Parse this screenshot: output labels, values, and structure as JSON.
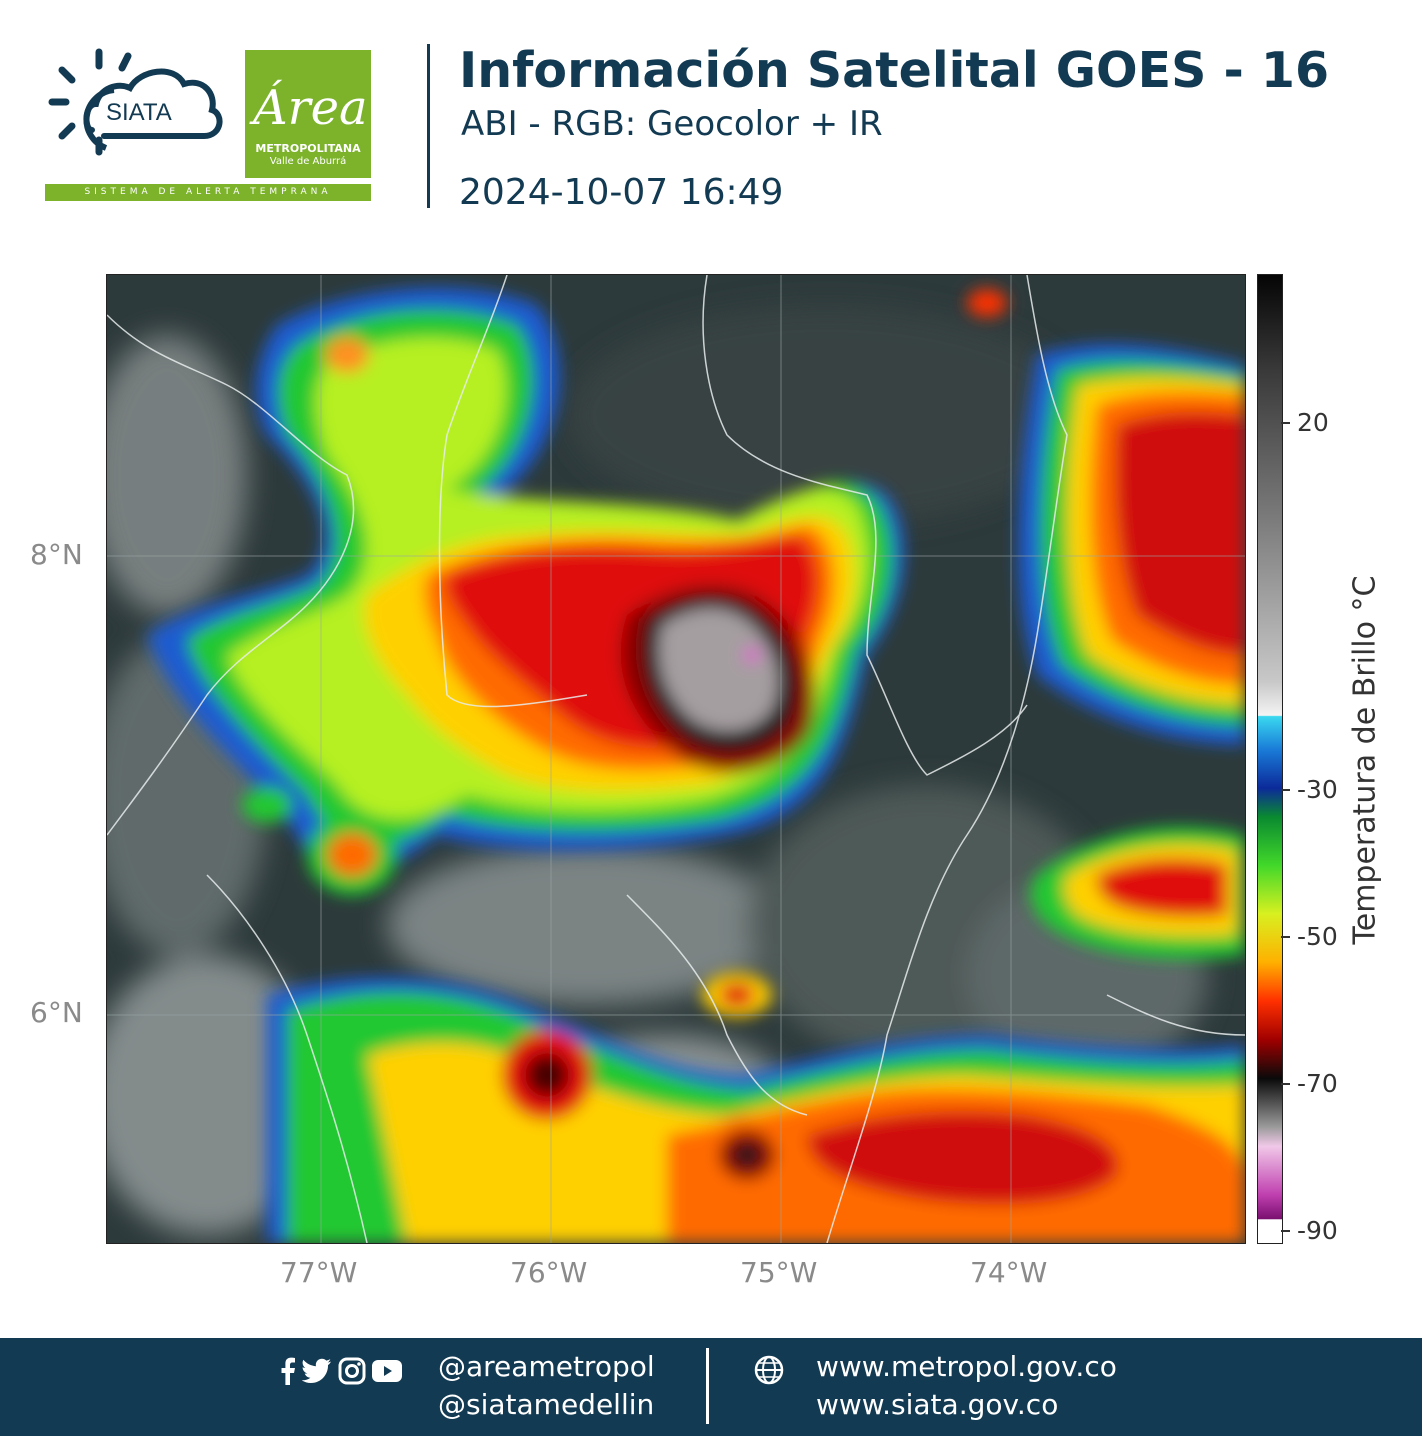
{
  "header": {
    "siata_text": "SIATA",
    "area_text": "Área",
    "area_line1": "METROPOLITANA",
    "area_line2": "Valle de Aburrá",
    "tagline": "SISTEMA DE ALERTA TEMPRANA",
    "title": "Información Satelital GOES - 16",
    "subtitle": "ABI - RGB: Geocolor + IR",
    "timestamp": "2024-10-07 16:49"
  },
  "map": {
    "lat_labels": [
      "8°N",
      "6°N"
    ],
    "lon_labels": [
      "77°W",
      "76°W",
      "75°W",
      "74°W"
    ]
  },
  "colorbar": {
    "title": "Temperatura de Brillo °C",
    "ticks": [
      "20",
      "-30",
      "-50",
      "-70",
      "-90"
    ]
  },
  "footer": {
    "handle_1": "@areametropol",
    "handle_2": "@siatamedellin",
    "url_1": "www.metropol.gov.co",
    "url_2": "www.siata.gov.co"
  },
  "colors": {
    "brand_navy": "#123a52",
    "brand_green": "#7cb32b"
  },
  "icons": [
    "sun-icon",
    "cloud-icon",
    "facebook-icon",
    "twitter-icon",
    "instagram-icon",
    "youtube-icon",
    "globe-icon"
  ]
}
